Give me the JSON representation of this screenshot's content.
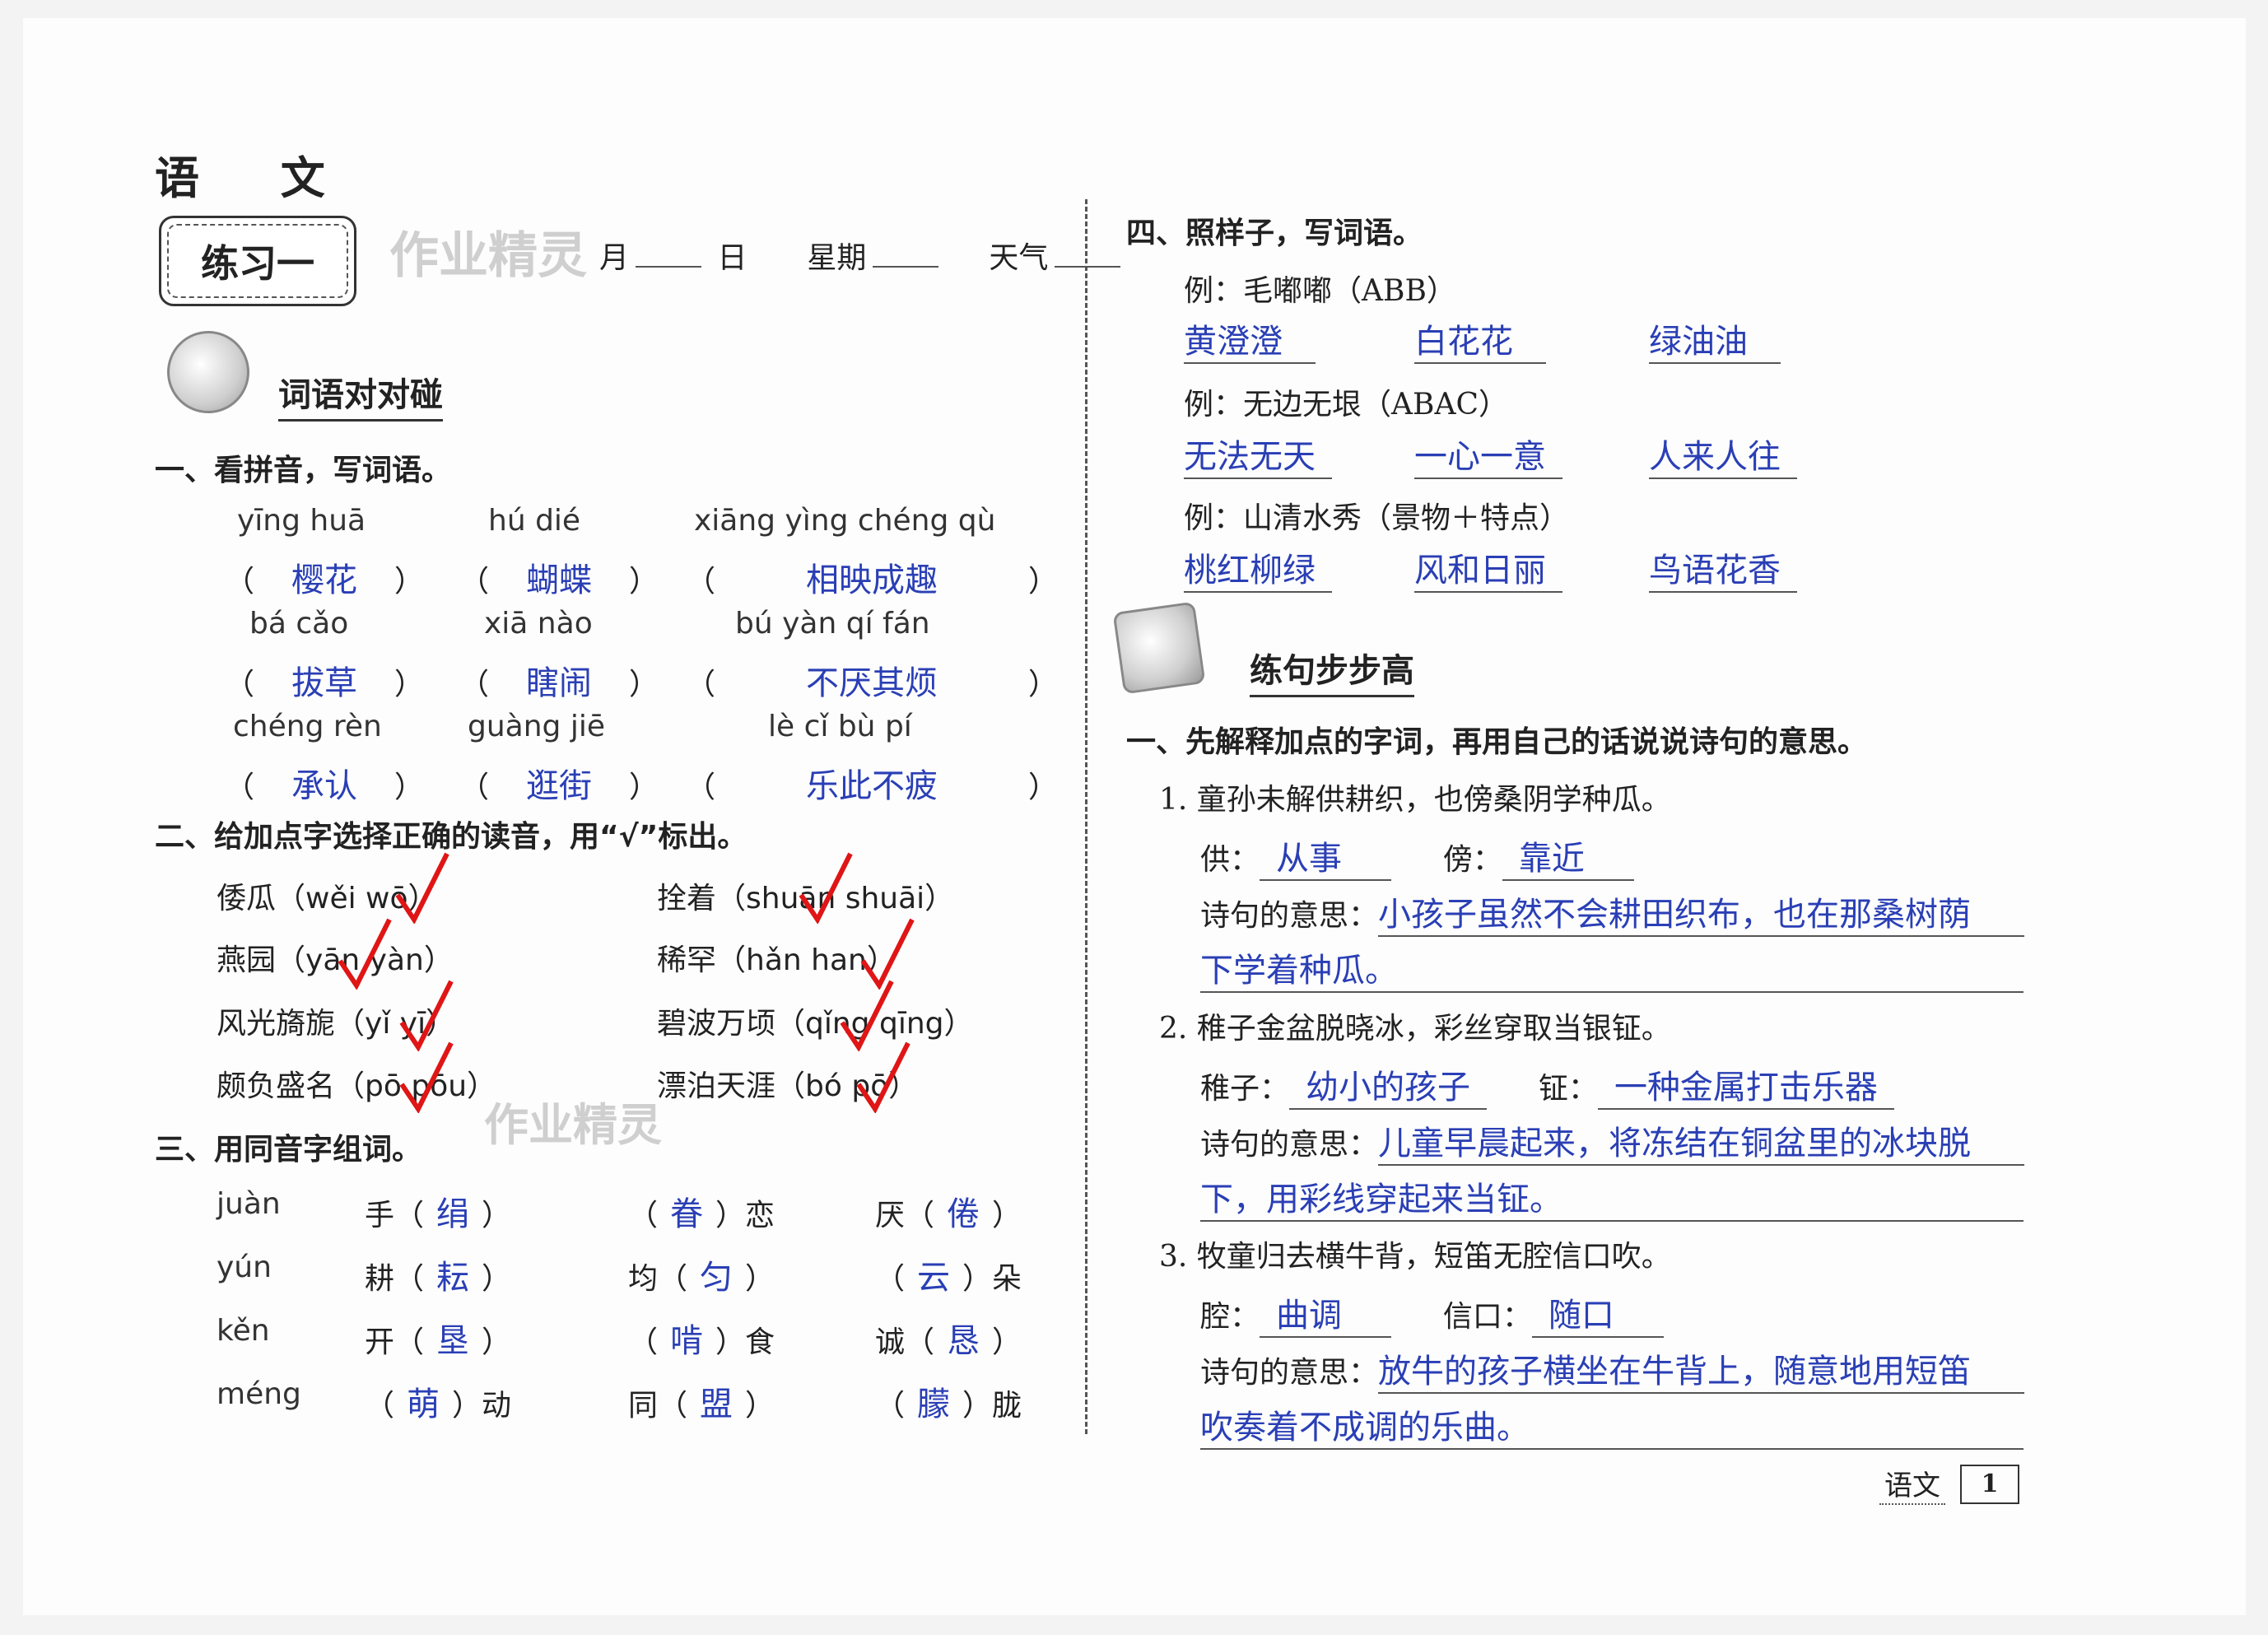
{
  "subject_title": "语 文",
  "exercise_label": "练习一",
  "date_line": {
    "month": "月",
    "day": "日",
    "weekday": "星期",
    "weather": "天气"
  },
  "watermark": "作业精灵",
  "left": {
    "section1_title": "词语对对碰",
    "q1": {
      "heading": "一、看拼音，写词语。",
      "items": [
        {
          "pinyin": "yīng huā",
          "answer": "樱花"
        },
        {
          "pinyin": "hú dié",
          "answer": "蝴蝶"
        },
        {
          "pinyin": "xiāng yìng chéng qù",
          "answer": "相映成趣"
        },
        {
          "pinyin": "bá cǎo",
          "answer": "拔草"
        },
        {
          "pinyin": "xiā nào",
          "answer": "瞎闹"
        },
        {
          "pinyin": "bú yàn qí fán",
          "answer": "不厌其烦"
        },
        {
          "pinyin": "chéng rèn",
          "answer": "承认"
        },
        {
          "pinyin": "guàng jiē",
          "answer": "逛街"
        },
        {
          "pinyin": "lè cǐ bù pí",
          "answer": "乐此不疲"
        }
      ]
    },
    "q2": {
      "heading": "二、给加点字选择正确的读音，用“√”标出。",
      "items": [
        {
          "word": "倭瓜",
          "options": "（wěi wō）"
        },
        {
          "word": "拴着",
          "options": "（shuān shuāi）"
        },
        {
          "word": "燕园",
          "options": "（yān yàn）"
        },
        {
          "word": "稀罕",
          "options": "（hǎn han）"
        },
        {
          "word": "风光旖旎",
          "options": "（yǐ yī）"
        },
        {
          "word": "碧波万顷",
          "options": "（qǐng qīng）"
        },
        {
          "word": "颇负盛名",
          "options": "（pō pōu）"
        },
        {
          "word": "漂泊天涯",
          "options": "（bó pō）"
        }
      ]
    },
    "q3": {
      "heading": "三、用同音字组词。",
      "rows": [
        {
          "pinyin": "juàn",
          "a_pre": "手",
          "a": "绢",
          "a_post": "",
          "b_pre": "",
          "b": "眷",
          "b_post": "恋",
          "c_pre": "厌",
          "c": "倦",
          "c_post": ""
        },
        {
          "pinyin": "yún",
          "a_pre": "耕",
          "a": "耘",
          "a_post": "",
          "b_pre": "均",
          "b": "匀",
          "b_post": "",
          "c_pre": "",
          "c": "云",
          "c_post": "朵"
        },
        {
          "pinyin": "kěn",
          "a_pre": "开",
          "a": "垦",
          "a_post": "",
          "b_pre": "",
          "b": "啃",
          "b_post": "食",
          "c_pre": "诚",
          "c": "恳",
          "c_post": ""
        },
        {
          "pinyin": "méng",
          "a_pre": "",
          "a": "萌",
          "a_post": "动",
          "b_pre": "同",
          "b": "盟",
          "b_post": "",
          "c_pre": "",
          "c": "朦",
          "c_post": "胧"
        }
      ]
    }
  },
  "right": {
    "q4": {
      "heading": "四、照样子，写词语。",
      "examples": [
        {
          "label": "例：毛嘟嘟（ABB）",
          "answers": [
            "黄澄澄",
            "白花花",
            "绿油油"
          ]
        },
        {
          "label": "例：无边无垠（ABAC）",
          "answers": [
            "无法无天",
            "一心一意",
            "人来人往"
          ]
        },
        {
          "label": "例：山清水秀（景物＋特点）",
          "answers": [
            "桃红柳绿",
            "风和日丽",
            "鸟语花香"
          ]
        }
      ]
    },
    "section2_title": "练句步步高",
    "q5": {
      "heading": "一、先解释加点的字词，再用自己的话说说诗句的意思。",
      "meaning_label": "诗句的意思：",
      "poems": [
        {
          "line": "1. 童孙未解供耕织，也傍桑阴学种瓜。",
          "t1": "供：",
          "a1": "从事",
          "t2": "傍：",
          "a2": "靠近",
          "meaning1": "小孩子虽然不会耕田织布，也在那桑树荫",
          "meaning2": "下学着种瓜。"
        },
        {
          "line": "2. 稚子金盆脱晓冰，彩丝穿取当银钲。",
          "t1": "稚子：",
          "a1": "幼小的孩子",
          "t2": "钲：",
          "a2": "一种金属打击乐器",
          "meaning1": "儿童早晨起来，将冻结在铜盆里的冰块脱",
          "meaning2": "下，用彩线穿起来当钲。"
        },
        {
          "line": "3. 牧童归去横牛背，短笛无腔信口吹。",
          "t1": "腔：",
          "a1": "曲调",
          "t2": "信口：",
          "a2": "随口",
          "meaning1": "放牛的孩子横坐在牛背上，随意地用短笛",
          "meaning2": "吹奏着不成调的乐曲。"
        }
      ]
    },
    "footer_subject": "语文",
    "page_number": "1"
  },
  "colors": {
    "answer_ink": "#2a3fb5",
    "check_mark": "#e01515"
  }
}
